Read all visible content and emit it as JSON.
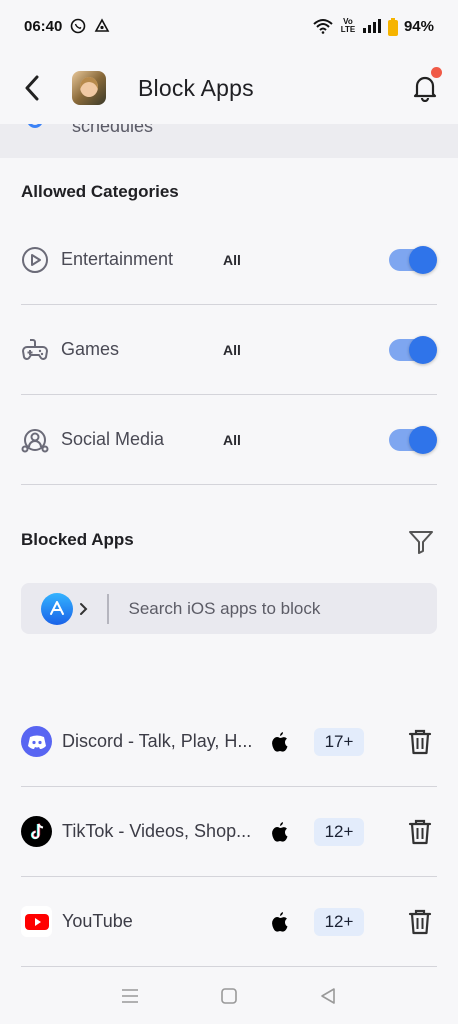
{
  "status_bar": {
    "time": "06:40",
    "network_label": "Vo LTE",
    "battery": "94%"
  },
  "header": {
    "title": "Block Apps",
    "has_notification": true
  },
  "schedules": {
    "partial_text": "schedules"
  },
  "allowed_categories": {
    "title": "Allowed Categories",
    "items": [
      {
        "name": "Entertainment",
        "scope": "All",
        "enabled": true,
        "icon": "play-circle-icon"
      },
      {
        "name": "Games",
        "scope": "All",
        "enabled": true,
        "icon": "gamepad-icon"
      },
      {
        "name": "Social Media",
        "scope": "All",
        "enabled": true,
        "icon": "people-icon"
      }
    ]
  },
  "blocked_apps": {
    "title": "Blocked Apps",
    "search": {
      "placeholder": "Search iOS apps to block",
      "store_icon": "app-store-icon"
    },
    "items": [
      {
        "name": "Discord - Talk, Play, H...",
        "platform": "ios",
        "age": "17+",
        "icon": "discord-icon"
      },
      {
        "name": "TikTok - Videos, Shop...",
        "platform": "ios",
        "age": "12+",
        "icon": "tiktok-icon"
      },
      {
        "name": "YouTube",
        "platform": "ios",
        "age": "12+",
        "icon": "youtube-icon"
      }
    ]
  },
  "colors": {
    "accent": "#2f74ea",
    "toggle_track": "#7ea6f0",
    "badge_bg": "#e3ecfb",
    "notification_dot": "#f05a47"
  }
}
